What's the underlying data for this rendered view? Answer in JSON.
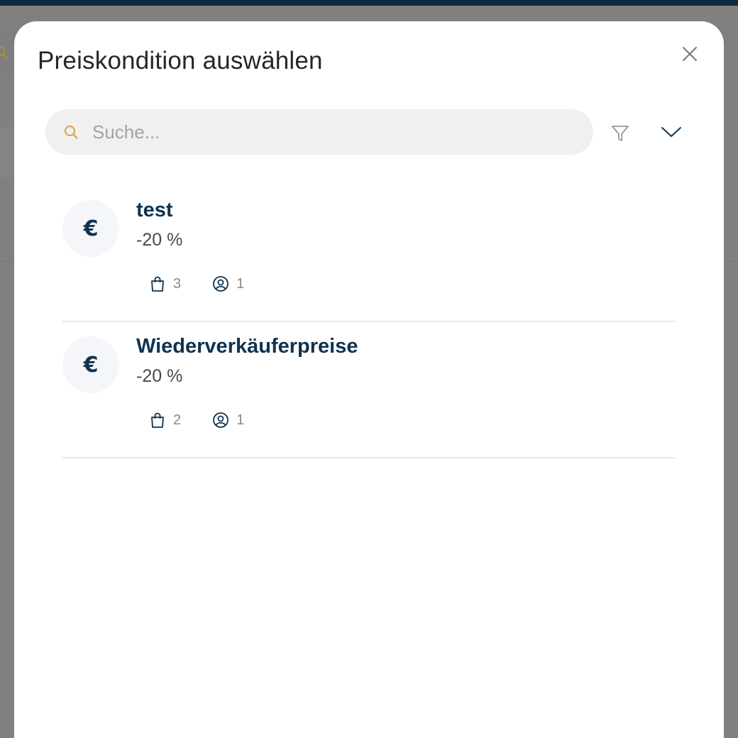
{
  "modal": {
    "title": "Preiskondition auswählen",
    "close_icon": "close-icon"
  },
  "search": {
    "placeholder": "Suche...",
    "value": "",
    "icon": "search-icon"
  },
  "toolbar": {
    "filter_icon": "filter-icon",
    "expand_icon": "chevron-down-icon"
  },
  "items": [
    {
      "avatar_glyph": "€",
      "name": "test",
      "discount": "-20 %",
      "products_count": "3",
      "customers_count": "1"
    },
    {
      "avatar_glyph": "€",
      "name": "Wiederverkäuferpreise",
      "discount": "-20 %",
      "products_count": "2",
      "customers_count": "1"
    }
  ],
  "colors": {
    "accent_search_icon": "#e0a040",
    "primary_text": "#0f3350",
    "header_bar": "#0f2a3f"
  }
}
